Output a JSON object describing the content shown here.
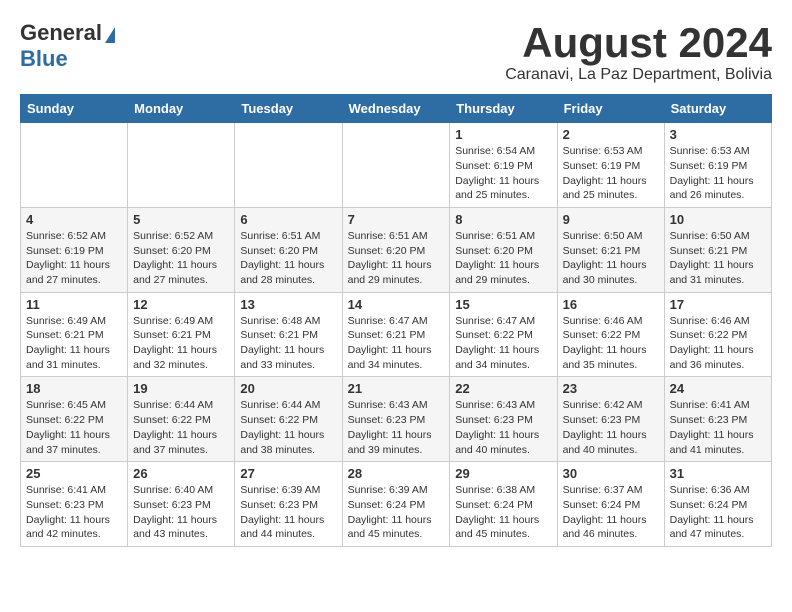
{
  "header": {
    "logo_general": "General",
    "logo_blue": "Blue",
    "month_title": "August 2024",
    "location": "Caranavi, La Paz Department, Bolivia"
  },
  "days_of_week": [
    "Sunday",
    "Monday",
    "Tuesday",
    "Wednesday",
    "Thursday",
    "Friday",
    "Saturday"
  ],
  "weeks": [
    [
      {
        "day": "",
        "info": ""
      },
      {
        "day": "",
        "info": ""
      },
      {
        "day": "",
        "info": ""
      },
      {
        "day": "",
        "info": ""
      },
      {
        "day": "1",
        "info": "Sunrise: 6:54 AM\nSunset: 6:19 PM\nDaylight: 11 hours and 25 minutes."
      },
      {
        "day": "2",
        "info": "Sunrise: 6:53 AM\nSunset: 6:19 PM\nDaylight: 11 hours and 25 minutes."
      },
      {
        "day": "3",
        "info": "Sunrise: 6:53 AM\nSunset: 6:19 PM\nDaylight: 11 hours and 26 minutes."
      }
    ],
    [
      {
        "day": "4",
        "info": "Sunrise: 6:52 AM\nSunset: 6:19 PM\nDaylight: 11 hours and 27 minutes."
      },
      {
        "day": "5",
        "info": "Sunrise: 6:52 AM\nSunset: 6:20 PM\nDaylight: 11 hours and 27 minutes."
      },
      {
        "day": "6",
        "info": "Sunrise: 6:51 AM\nSunset: 6:20 PM\nDaylight: 11 hours and 28 minutes."
      },
      {
        "day": "7",
        "info": "Sunrise: 6:51 AM\nSunset: 6:20 PM\nDaylight: 11 hours and 29 minutes."
      },
      {
        "day": "8",
        "info": "Sunrise: 6:51 AM\nSunset: 6:20 PM\nDaylight: 11 hours and 29 minutes."
      },
      {
        "day": "9",
        "info": "Sunrise: 6:50 AM\nSunset: 6:21 PM\nDaylight: 11 hours and 30 minutes."
      },
      {
        "day": "10",
        "info": "Sunrise: 6:50 AM\nSunset: 6:21 PM\nDaylight: 11 hours and 31 minutes."
      }
    ],
    [
      {
        "day": "11",
        "info": "Sunrise: 6:49 AM\nSunset: 6:21 PM\nDaylight: 11 hours and 31 minutes."
      },
      {
        "day": "12",
        "info": "Sunrise: 6:49 AM\nSunset: 6:21 PM\nDaylight: 11 hours and 32 minutes."
      },
      {
        "day": "13",
        "info": "Sunrise: 6:48 AM\nSunset: 6:21 PM\nDaylight: 11 hours and 33 minutes."
      },
      {
        "day": "14",
        "info": "Sunrise: 6:47 AM\nSunset: 6:21 PM\nDaylight: 11 hours and 34 minutes."
      },
      {
        "day": "15",
        "info": "Sunrise: 6:47 AM\nSunset: 6:22 PM\nDaylight: 11 hours and 34 minutes."
      },
      {
        "day": "16",
        "info": "Sunrise: 6:46 AM\nSunset: 6:22 PM\nDaylight: 11 hours and 35 minutes."
      },
      {
        "day": "17",
        "info": "Sunrise: 6:46 AM\nSunset: 6:22 PM\nDaylight: 11 hours and 36 minutes."
      }
    ],
    [
      {
        "day": "18",
        "info": "Sunrise: 6:45 AM\nSunset: 6:22 PM\nDaylight: 11 hours and 37 minutes."
      },
      {
        "day": "19",
        "info": "Sunrise: 6:44 AM\nSunset: 6:22 PM\nDaylight: 11 hours and 37 minutes."
      },
      {
        "day": "20",
        "info": "Sunrise: 6:44 AM\nSunset: 6:22 PM\nDaylight: 11 hours and 38 minutes."
      },
      {
        "day": "21",
        "info": "Sunrise: 6:43 AM\nSunset: 6:23 PM\nDaylight: 11 hours and 39 minutes."
      },
      {
        "day": "22",
        "info": "Sunrise: 6:43 AM\nSunset: 6:23 PM\nDaylight: 11 hours and 40 minutes."
      },
      {
        "day": "23",
        "info": "Sunrise: 6:42 AM\nSunset: 6:23 PM\nDaylight: 11 hours and 40 minutes."
      },
      {
        "day": "24",
        "info": "Sunrise: 6:41 AM\nSunset: 6:23 PM\nDaylight: 11 hours and 41 minutes."
      }
    ],
    [
      {
        "day": "25",
        "info": "Sunrise: 6:41 AM\nSunset: 6:23 PM\nDaylight: 11 hours and 42 minutes."
      },
      {
        "day": "26",
        "info": "Sunrise: 6:40 AM\nSunset: 6:23 PM\nDaylight: 11 hours and 43 minutes."
      },
      {
        "day": "27",
        "info": "Sunrise: 6:39 AM\nSunset: 6:23 PM\nDaylight: 11 hours and 44 minutes."
      },
      {
        "day": "28",
        "info": "Sunrise: 6:39 AM\nSunset: 6:24 PM\nDaylight: 11 hours and 45 minutes."
      },
      {
        "day": "29",
        "info": "Sunrise: 6:38 AM\nSunset: 6:24 PM\nDaylight: 11 hours and 45 minutes."
      },
      {
        "day": "30",
        "info": "Sunrise: 6:37 AM\nSunset: 6:24 PM\nDaylight: 11 hours and 46 minutes."
      },
      {
        "day": "31",
        "info": "Sunrise: 6:36 AM\nSunset: 6:24 PM\nDaylight: 11 hours and 47 minutes."
      }
    ]
  ]
}
